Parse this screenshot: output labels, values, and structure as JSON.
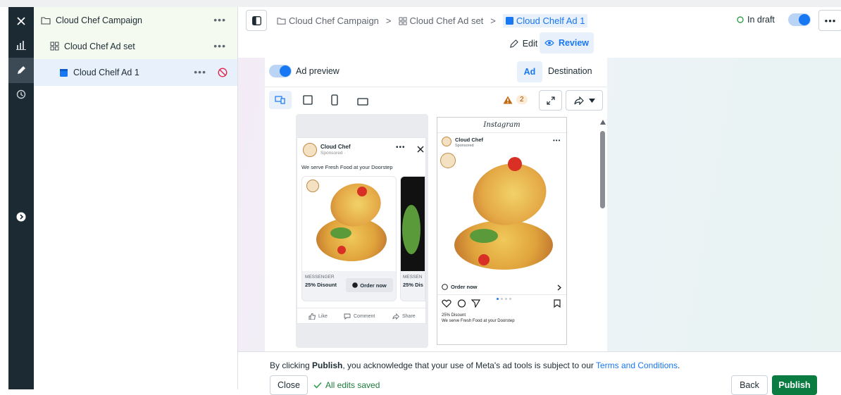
{
  "sidebar_tree": {
    "campaign": "Cloud Chef Campaign",
    "adset": "Cloud Chef Ad set",
    "ad": "Cloud Chelf Ad 1",
    "more": "•••"
  },
  "breadcrumb": {
    "campaign": "Cloud Chef Campaign",
    "adset": "Cloud Chef Ad set",
    "ad": "Cloud Chelf Ad 1",
    "sep": ">"
  },
  "status": {
    "label": "In draft"
  },
  "modes": {
    "edit": "Edit",
    "review": "Review"
  },
  "preview": {
    "toggle_label": "Ad preview",
    "tabs": [
      "Ad",
      "Destination"
    ],
    "warning_count": "2"
  },
  "facebook_ad": {
    "page_name": "Cloud Chef",
    "sponsored": "Sponsored · ",
    "primary_text": "We serve Fresh Food at your Doorstep",
    "card1": {
      "source": "MESSENGER",
      "headline": "25% Disount",
      "cta": "Order now"
    },
    "card2": {
      "source": "MESSEN",
      "headline": "25% Dis"
    },
    "actions": [
      "Like",
      "Comment",
      "Share"
    ]
  },
  "instagram_ad": {
    "header": "Instagram",
    "page_name": "Cloud Chef",
    "sponsored": "Sponsored",
    "cta": "Order now",
    "caption_title": "25% Disount",
    "caption": "We serve Fresh Food at your Doorstep"
  },
  "footer": {
    "terms_prefix": "By clicking ",
    "terms_bold": "Publish",
    "terms_mid": ", you acknowledge that your use of Meta's ad tools is subject to our ",
    "terms_link": "Terms and Conditions",
    "terms_end": ".",
    "close": "Close",
    "saved": "All edits saved",
    "back": "Back",
    "publish": "Publish"
  },
  "colors": {
    "accent": "#1877f2",
    "publish": "#0a7c42",
    "rail": "#1c2b33",
    "selected": "#e7f0fb"
  }
}
